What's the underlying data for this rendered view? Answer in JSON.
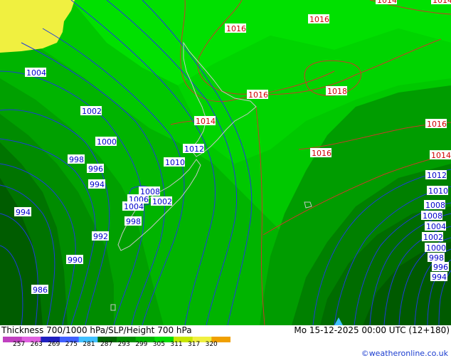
{
  "title": {
    "left": "Thickness 700/1000 hPa/SLP/Height 700 hPa",
    "right": "Mo 15-12-2025 00:00 UTC (12+180)"
  },
  "credit": "©weatheronline.co.uk",
  "legend": {
    "ticks": [
      "257",
      "263",
      "269",
      "275",
      "281",
      "287",
      "293",
      "299",
      "305",
      "311",
      "317",
      "320"
    ],
    "colors": [
      "#c040c0",
      "#e060e0",
      "#2020c0",
      "#4060ff",
      "#40c0ff",
      "#006400",
      "#008c00",
      "#00b400",
      "#00dc00",
      "#c8e600",
      "#f0f040",
      "#f0a000"
    ]
  },
  "colors": {
    "thickness_darkest": "#005c00",
    "thickness_dark": "#007400",
    "thickness_mid": "#008c00",
    "thickness_mid2": "#00a000",
    "thickness_light": "#00b800",
    "thickness_lighter": "#00cc00",
    "thickness_lightest": "#00e000",
    "thickness_yellow": "#f0f040",
    "height_contour": "#1e3cdc",
    "slp_contour": "#c83c28",
    "coastline": "#c0c0c0"
  },
  "height_labels": [
    "1004",
    "1002",
    "1000",
    "998",
    "996",
    "994",
    "994",
    "992",
    "990",
    "986",
    "1012",
    "1010",
    "1008",
    "1006",
    "1004",
    "1002",
    "998",
    "1012",
    "1010",
    "1008",
    "1008",
    "1004",
    "1002",
    "1000",
    "998",
    "996",
    "994"
  ],
  "slp_labels": [
    "1014",
    "1016",
    "1016",
    "1016",
    "1018",
    "1016",
    "1014",
    "1016",
    "1014",
    "1014"
  ]
}
